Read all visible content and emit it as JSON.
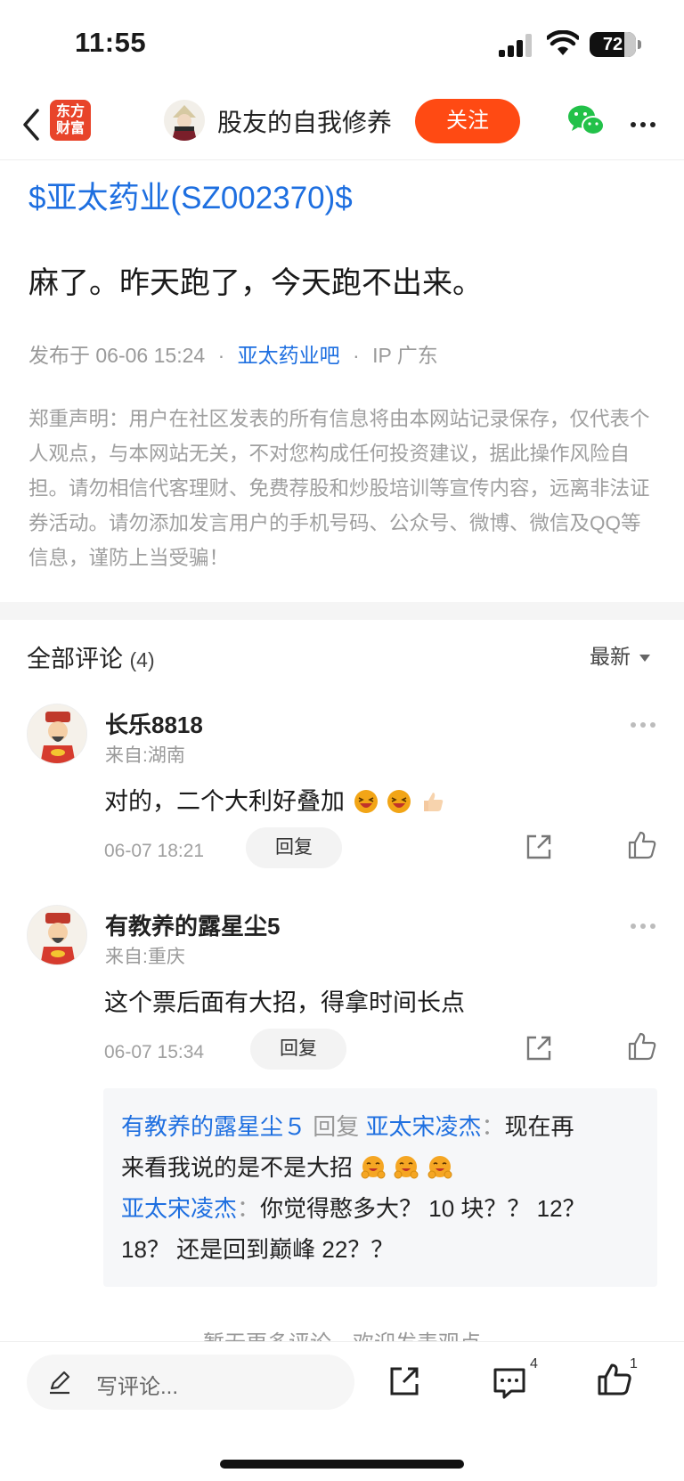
{
  "status_bar": {
    "time": "11:55",
    "battery": "72"
  },
  "nav": {
    "logo_text_line1": "东方",
    "logo_text_line2": "财富",
    "author_name": "股友的自我修养",
    "follow_label": "关注"
  },
  "post": {
    "stock_link": "$亚太药业(SZ002370)$",
    "text": "麻了。昨天跑了，今天跑不出来。",
    "meta_published": "发布于 06-06 15:24",
    "meta_sep": "·",
    "meta_bar": "亚太药业吧",
    "meta_ip": "IP 广东",
    "disclaimer": "郑重声明：用户在社区发表的所有信息将由本网站记录保存，仅代表个人观点，与本网站无关，不对您构成任何投资建议，据此操作风险自担。请勿相信代客理财、免费荐股和炒股培训等宣传内容，远离非法证券活动。请勿添加发言用户的手机号码、公众号、微博、微信及QQ等信息，谨防上当受骗！"
  },
  "comments_header": {
    "title": "全部评论",
    "count": "(4)",
    "sort_label": "最新"
  },
  "comments": [
    {
      "name": "长乐8818",
      "location": "来自:湖南",
      "text": "对的，二个大利好叠加",
      "time": "06-07 18:21",
      "reply_label": "回复"
    },
    {
      "name": "有教养的露星尘5",
      "location": "来自:重庆",
      "text": "这个票后面有大招，得拿时间长点",
      "time": "06-07 15:34",
      "reply_label": "回复"
    }
  ],
  "replies": {
    "r1_user": "有教养的露星尘５",
    "r1_reply_word": "回复",
    "r1_target": "亚太宋凌杰",
    "r1_colon": "：",
    "r1_text_line1": "现在再",
    "r1_text_line2": "来看我说的是不是大招",
    "r2_user": "亚太宋凌杰",
    "r2_colon": "：",
    "r2_text_line1": "你觉得憨多大？ 10 块？？ 12？",
    "r2_text_line2": "18？ 还是回到巅峰 22？？"
  },
  "no_more": "暂无更多评论，欢迎发表观点",
  "bottom_bar": {
    "input_placeholder": "写评论...",
    "comment_count": "4",
    "like_count": "1"
  }
}
